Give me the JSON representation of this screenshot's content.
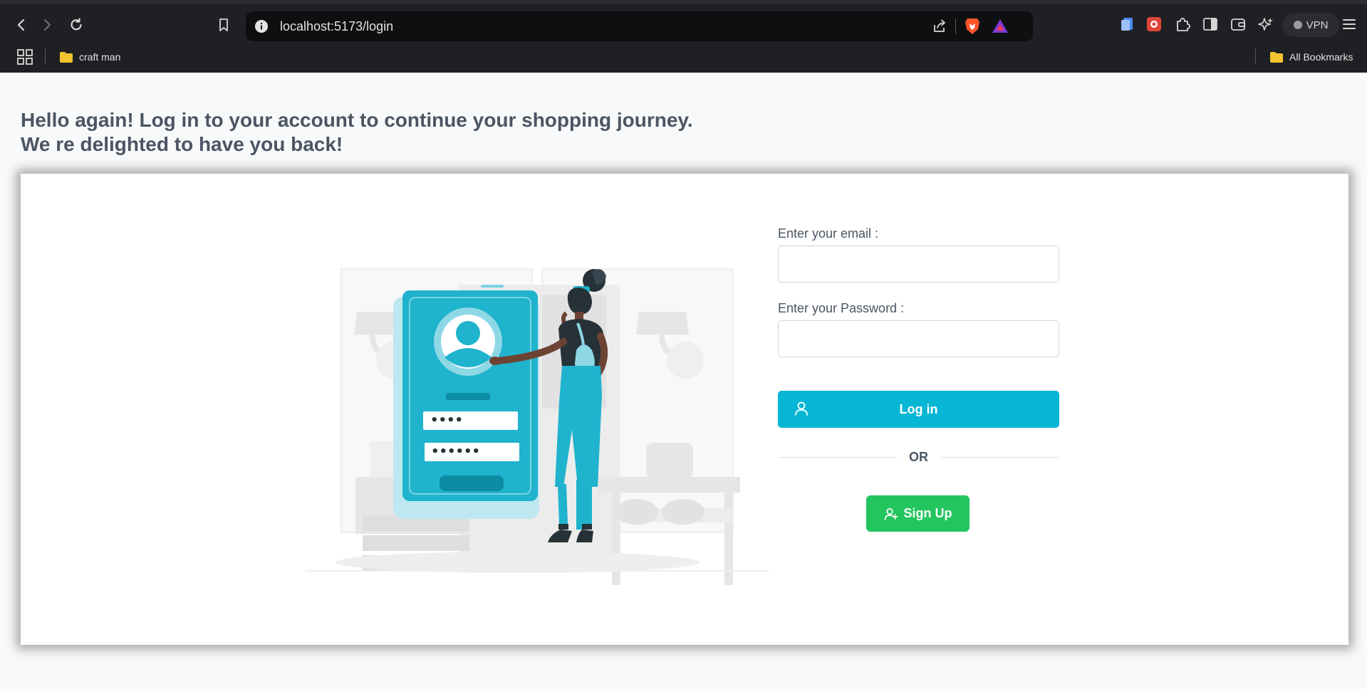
{
  "browser": {
    "url": "localhost:5173/login",
    "vpn_label": "VPN",
    "bookmarks": [
      {
        "label": "craft man"
      }
    ],
    "all_bookmarks_label": "All Bookmarks"
  },
  "page": {
    "heading_line1": "Hello again! Log in to your account to continue your shopping journey.",
    "heading_line2": "We re delighted to have you back!"
  },
  "form": {
    "email_label": "Enter your email :",
    "email_value": "",
    "password_label": "Enter your Password :",
    "password_value": "",
    "login_label": "Log in",
    "or_label": "OR",
    "signup_label": "Sign Up"
  },
  "illustration": {
    "pin_mask": "••••",
    "password_mask": "••••••"
  },
  "colors": {
    "accent": "#06b6d4",
    "signup": "#22c55e",
    "heading": "#4b5563"
  }
}
